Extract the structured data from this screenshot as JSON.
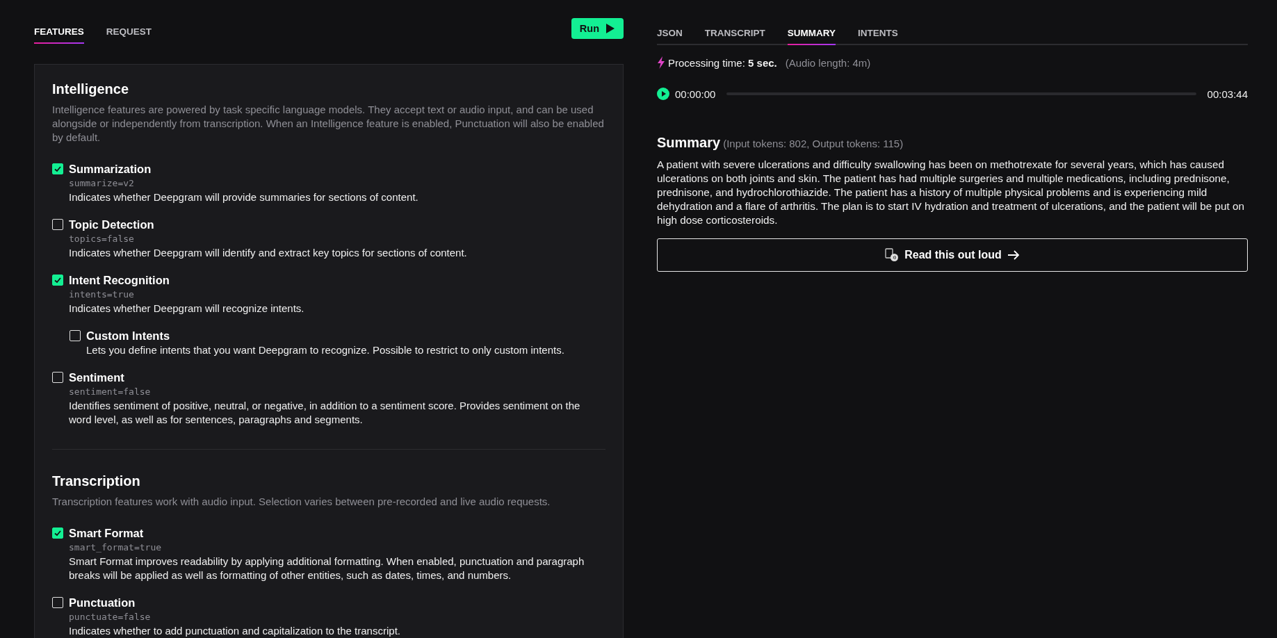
{
  "left_tabs": [
    {
      "label": "FEATURES",
      "selected": true
    },
    {
      "label": "REQUEST",
      "selected": false
    }
  ],
  "run_button": {
    "label": "Run"
  },
  "sections": [
    {
      "title": "Intelligence",
      "description": "Intelligence features are powered by task specific language models. They accept text or audio input, and can be used alongside or independently from transcription. When an Intelligence feature is enabled, Punctuation will also be enabled by default.",
      "features": [
        {
          "label": "Summarization",
          "checked": true,
          "param": "summarize=v2",
          "description": "Indicates whether Deepgram will provide summaries for sections of content."
        },
        {
          "label": "Topic Detection",
          "checked": false,
          "param": "topics=false",
          "description": "Indicates whether Deepgram will identify and extract key topics for sections of content."
        },
        {
          "label": "Intent Recognition",
          "checked": true,
          "param": "intents=true",
          "description": "Indicates whether Deepgram will recognize intents.",
          "children": [
            {
              "label": "Custom Intents",
              "checked": false,
              "description": "Lets you define intents that you want Deepgram to recognize. Possible to restrict to only custom intents."
            }
          ]
        },
        {
          "label": "Sentiment",
          "checked": false,
          "param": "sentiment=false",
          "description": "Identifies sentiment of positive, neutral, or negative, in addition to a sentiment score. Provides sentiment on the word level, as well as for sentences, paragraphs and segments."
        }
      ]
    },
    {
      "title": "Transcription",
      "description": "Transcription features work with audio input. Selection varies between pre-recorded and live audio requests.",
      "features": [
        {
          "label": "Smart Format",
          "checked": true,
          "param": "smart_format=true",
          "description": "Smart Format improves readability by applying additional formatting. When enabled, punctuation and paragraph breaks will be applied as well as formatting of other entities, such as dates, times, and numbers."
        },
        {
          "label": "Punctuation",
          "checked": false,
          "param": "punctuate=false",
          "description": "Indicates whether to add punctuation and capitalization to the transcript."
        }
      ]
    }
  ],
  "right_tabs": [
    {
      "label": "JSON",
      "selected": false
    },
    {
      "label": "TRANSCRIPT",
      "selected": false
    },
    {
      "label": "SUMMARY",
      "selected": true
    },
    {
      "label": "INTENTS",
      "selected": false
    }
  ],
  "processing": {
    "text": "Processing time: **5 sec.**",
    "audio_length": "(Audio length: 4m)"
  },
  "player": {
    "current_time": "00:00:00",
    "total_time": "00:03:44"
  },
  "summary": {
    "title": "Summary",
    "tokens": "(Input tokens: 802, Output tokens: 115)",
    "text": "A patient with severe ulcerations and difficulty swallowing has been on methotrexate for several years, which has caused ulcerations on both joints and skin. The patient has had multiple surgeries and multiple medications, including prednisone, prednisone, and hydrochlorothiazide. The patient has a history of multiple physical problems and is experiencing mild dehydration and a flare of arthritis. The plan is to start IV hydration and treatment of ulcerations, and the patient will be put on high dose corticosteroids."
  },
  "read_button": {
    "label": "Read this out loud"
  }
}
